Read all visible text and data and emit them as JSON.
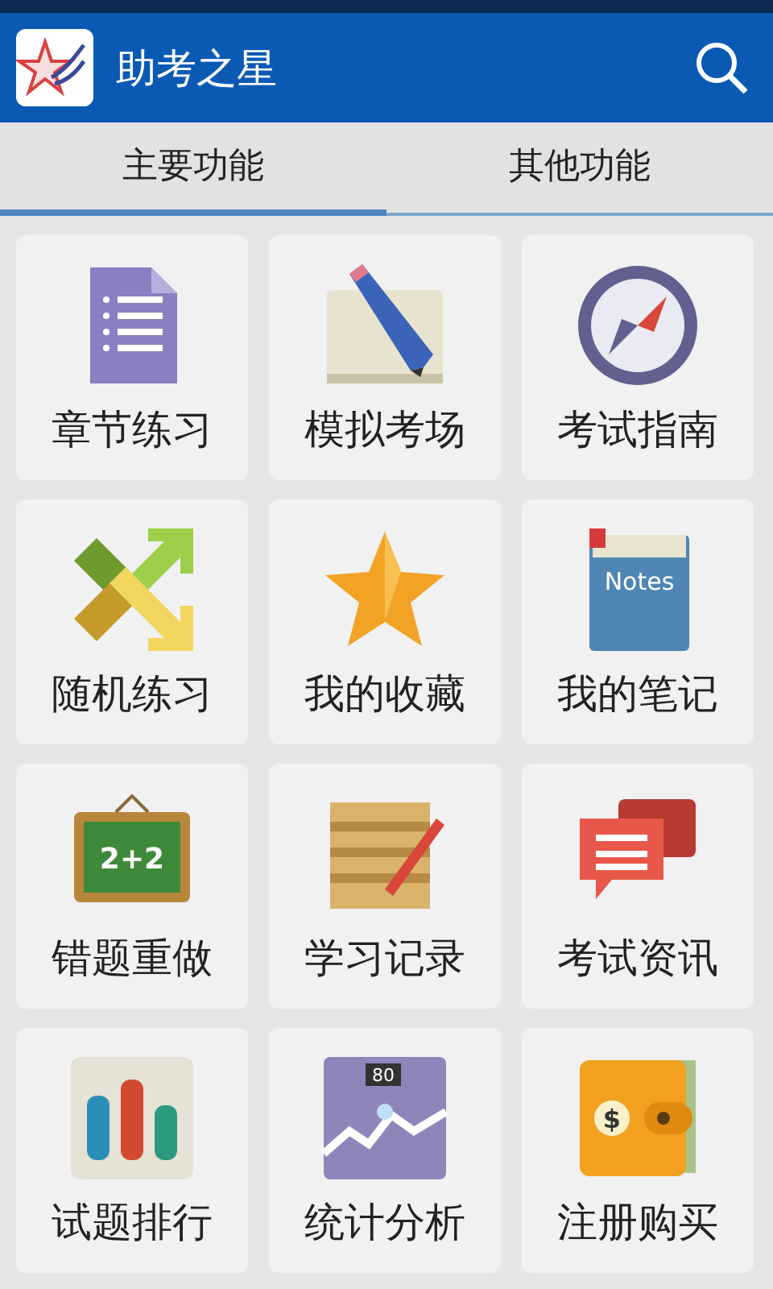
{
  "app_bar": {
    "title": "助考之星"
  },
  "tabs": [
    {
      "label": "主要功能",
      "selected": true
    },
    {
      "label": "其他功能",
      "selected": false
    }
  ],
  "features": [
    {
      "kind": "document",
      "label": "章节练习"
    },
    {
      "kind": "pencil",
      "label": "模拟考场"
    },
    {
      "kind": "compass",
      "label": "考试指南"
    },
    {
      "kind": "shuffle",
      "label": "随机练习"
    },
    {
      "kind": "star",
      "label": "我的收藏"
    },
    {
      "kind": "notebook",
      "label": "我的笔记",
      "icon_text": "Notes"
    },
    {
      "kind": "chalkboard",
      "label": "错题重做",
      "icon_text": "2+2"
    },
    {
      "kind": "scroll",
      "label": "学习记录"
    },
    {
      "kind": "chat",
      "label": "考试资讯"
    },
    {
      "kind": "bars",
      "label": "试题排行"
    },
    {
      "kind": "graph",
      "label": "统计分析",
      "icon_text": "80"
    },
    {
      "kind": "wallet",
      "label": "注册购买",
      "icon_text": "$"
    }
  ]
}
